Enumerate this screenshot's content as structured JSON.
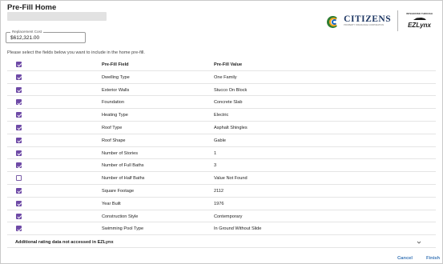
{
  "header": {
    "title": "Pre-Fill Home"
  },
  "replacement_cost": {
    "label": "Replacement Cost",
    "value": "$612,321.00"
  },
  "logos": {
    "citizens_name": "CITIZENS",
    "citizens_sub": "PROPERTY INSURANCE CORPORATION",
    "ezlynx_top": "INTEGRATED THROUGH",
    "ezlynx_name": "EZLynx"
  },
  "instructions": "Please select the fields below you want to include in the home pre-fill.",
  "table": {
    "header": {
      "field": "Pre-Fill Field",
      "value": "Pre-Fill Value",
      "checked": true
    },
    "rows": [
      {
        "field": "Dwelling Type",
        "value": "One Family",
        "checked": true
      },
      {
        "field": "Exterior Walls",
        "value": "Stucco On Block",
        "checked": true
      },
      {
        "field": "Foundation",
        "value": "Concrete Slab",
        "checked": true
      },
      {
        "field": "Heating Type",
        "value": "Electric",
        "checked": true
      },
      {
        "field": "Roof Type",
        "value": "Asphalt Shingles",
        "checked": true
      },
      {
        "field": "Roof Shape",
        "value": "Gable",
        "checked": true
      },
      {
        "field": "Number of Stories",
        "value": "1",
        "checked": true
      },
      {
        "field": "Number of Full Baths",
        "value": "3",
        "checked": true
      },
      {
        "field": "Number of Half Baths",
        "value": "Value Not Found",
        "checked": false
      },
      {
        "field": "Square Footage",
        "value": "2112",
        "checked": true
      },
      {
        "field": "Year Built",
        "value": "1976",
        "checked": true
      },
      {
        "field": "Construction Style",
        "value": "Contemporary",
        "checked": true
      },
      {
        "field": "Swimming Pool Type",
        "value": "In Ground Without Slide",
        "checked": true
      }
    ]
  },
  "accordion": {
    "label": "Additional rating data not accessed in EZLynx"
  },
  "footer": {
    "cancel_label": "Cancel",
    "finish_label": "Finish"
  },
  "colors": {
    "checkbox": "#6e4aa6",
    "button_text": "#3d78b8",
    "citizens_text": "#1f3864"
  }
}
